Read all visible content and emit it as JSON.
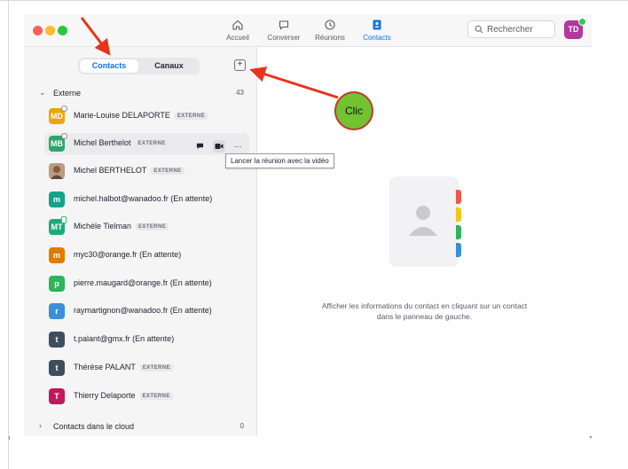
{
  "nav": {
    "home": "Accueil",
    "chat": "Converser",
    "meetings": "Réunions",
    "contacts": "Contacts"
  },
  "search": {
    "placeholder": "Rechercher"
  },
  "user": {
    "initials": "TD"
  },
  "tabs": {
    "contacts": "Contacts",
    "channels": "Canaux"
  },
  "groups": {
    "external": {
      "name": "Externe",
      "count": "43"
    },
    "cloud": {
      "name": "Contacts dans le cloud",
      "count": "0"
    }
  },
  "contacts": [
    {
      "initials": "MD",
      "name": "Marie-Louise DELAPORTE",
      "badge": "EXTERNE",
      "color": "#f0a30a"
    },
    {
      "initials": "MB",
      "name": "Michel Berthelot",
      "badge": "EXTERNE",
      "color": "#2ea66b"
    },
    {
      "initials": "",
      "name": "Michel BERTHELOT",
      "badge": "EXTERNE",
      "color": "#a0522d"
    },
    {
      "initials": "m",
      "name": "michel.halbot@wanadoo.fr (En attente)",
      "badge": "",
      "color": "#14a38b"
    },
    {
      "initials": "MT",
      "name": "Michèle Tielman",
      "badge": "EXTERNE",
      "color": "#1ea97c"
    },
    {
      "initials": "m",
      "name": "myc30@orange.fr (En attente)",
      "badge": "",
      "color": "#e07b00"
    },
    {
      "initials": "p",
      "name": "pierre.maugard@orange.fr (En attente)",
      "badge": "",
      "color": "#2fb45a"
    },
    {
      "initials": "r",
      "name": "raymartignon@wanadoo.fr (En attente)",
      "badge": "",
      "color": "#3a8fd9"
    },
    {
      "initials": "t",
      "name": "t.palant@gmx.fr (En attente)",
      "badge": "",
      "color": "#3f4e5e"
    },
    {
      "initials": "t",
      "name": "Thérèse PALANT",
      "badge": "EXTERNE",
      "color": "#3f4e5e"
    },
    {
      "initials": "T",
      "name": "Thierry Delaporte",
      "badge": "EXTERNE",
      "color": "#c2185b"
    }
  ],
  "tooltip": "Lancer la réunion avec la vidéo",
  "empty": {
    "line1": "Afficher les informations du contact en cliquant sur un contact",
    "line2": "dans le panneau de gauche."
  },
  "annotation": {
    "label": "Clic"
  },
  "colors": {
    "accent": "#0e72ed",
    "arrow": "#e8341c",
    "clic_bg": "#72c232"
  }
}
